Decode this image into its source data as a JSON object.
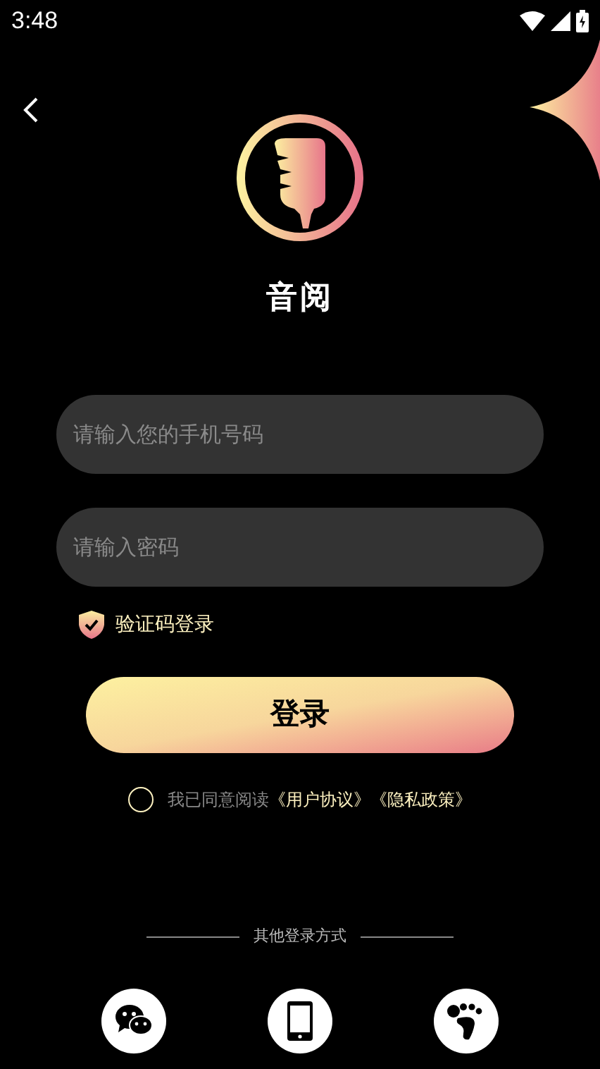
{
  "status_bar": {
    "time": "3:48"
  },
  "app": {
    "name": "音阅"
  },
  "form": {
    "phone": {
      "placeholder": "请输入您的手机号码"
    },
    "password": {
      "placeholder": "请输入密码"
    }
  },
  "verify_login": {
    "label": "验证码登录"
  },
  "login_button": {
    "label": "登录"
  },
  "agreement": {
    "checked": false,
    "text": "我已同意阅读",
    "links": [
      "《用户协议》",
      "《隐私政策》"
    ]
  },
  "other_login": {
    "title": "其他登录方式",
    "methods": [
      {
        "kind": "wechat"
      },
      {
        "kind": "phone"
      },
      {
        "kind": "footprint"
      }
    ]
  }
}
